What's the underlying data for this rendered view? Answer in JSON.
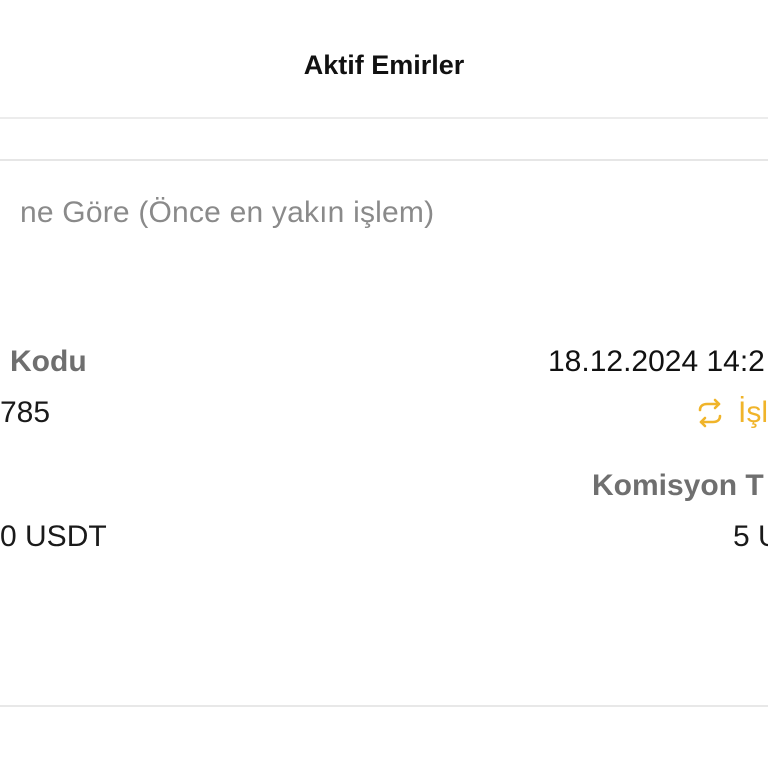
{
  "header": {
    "title": "Aktif Emirler"
  },
  "sort": {
    "label": "ne Göre (Önce en yakın işlem)"
  },
  "order": {
    "code_label": "Kodu",
    "code_value": "785",
    "datetime": "18.12.2024 14:2",
    "status_text": "İşl",
    "status_icon": "repeat-arrows-icon",
    "amount_value": "0 USDT",
    "commission_label": "Komisyon T",
    "commission_value": "5 U"
  },
  "colors": {
    "status_accent": "#f0b42a",
    "label_gray": "#6f6f6f",
    "placeholder_gray": "#8a8a8a"
  }
}
